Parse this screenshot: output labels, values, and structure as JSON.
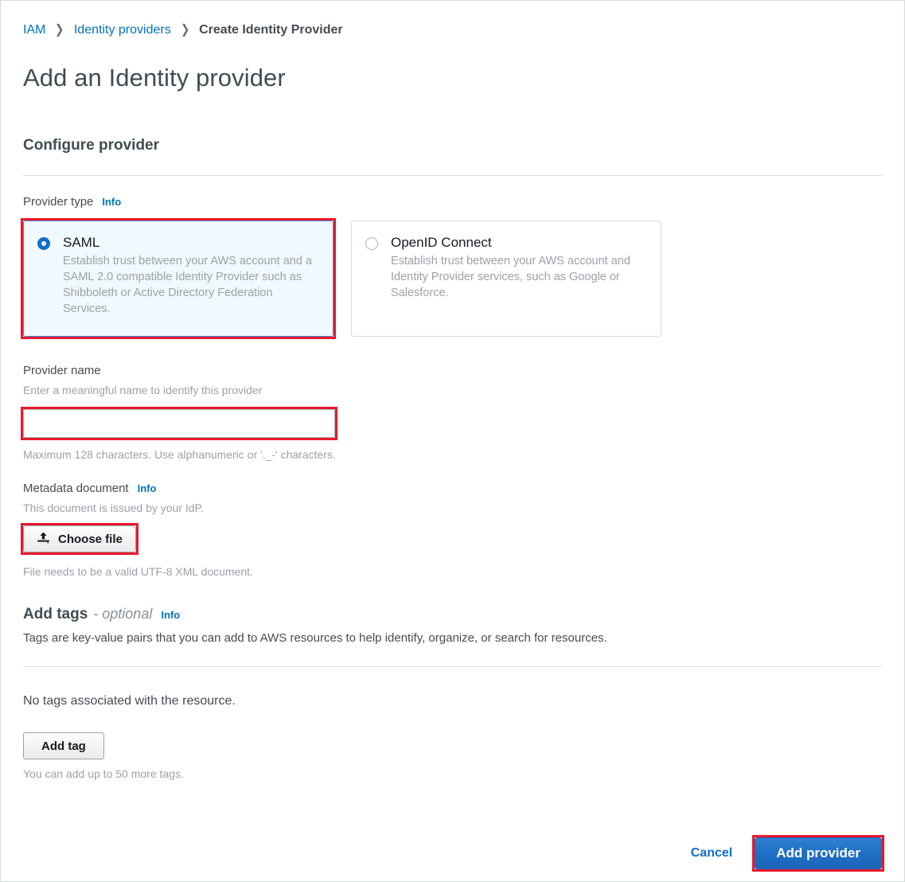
{
  "breadcrumb": {
    "items": [
      {
        "label": "IAM",
        "type": "link"
      },
      {
        "label": "Identity providers",
        "type": "link"
      },
      {
        "label": "Create Identity Provider",
        "type": "current"
      }
    ],
    "separator": "❯"
  },
  "page": {
    "title": "Add an Identity provider"
  },
  "configure": {
    "section_title": "Configure provider",
    "provider_type": {
      "label": "Provider type",
      "info_label": "Info",
      "options": [
        {
          "id": "saml",
          "title": "SAML",
          "description": "Establish trust between your AWS account and a SAML 2.0 compatible Identity Provider such as Shibboleth or Active Directory Federation Services.",
          "selected": true,
          "highlighted": true
        },
        {
          "id": "oidc",
          "title": "OpenID Connect",
          "description": "Establish trust between your AWS account and Identity Provider services, such as Google or Salesforce.",
          "selected": false,
          "highlighted": false
        }
      ]
    },
    "provider_name": {
      "label": "Provider name",
      "hint": "Enter a meaningful name to identify this provider",
      "value": "",
      "placeholder": "",
      "constraint": "Maximum 128 characters. Use alphanumeric or '._-' characters."
    },
    "metadata_document": {
      "label": "Metadata document",
      "info_label": "Info",
      "hint": "This document is issued by your IdP.",
      "choose_file_label": "Choose file",
      "choose_file_icon": "upload-icon",
      "constraint": "File needs to be a valid UTF-8 XML document."
    }
  },
  "tags": {
    "heading": "Add tags",
    "optional_label": "- optional",
    "info_label": "Info",
    "description": "Tags are key-value pairs that you can add to AWS resources to help identify, organize, or search for resources.",
    "empty_message": "No tags associated with the resource.",
    "add_tag_label": "Add tag",
    "limit_hint": "You can add up to 50 more tags."
  },
  "footer": {
    "cancel_label": "Cancel",
    "submit_label": "Add provider",
    "submit_highlighted": true
  },
  "colors": {
    "link_blue": "#0073bb",
    "primary_blue": "#1f6fc4",
    "highlight_red": "#e8192c",
    "selected_tile_bg": "#f1f8fe",
    "selected_tile_border": "#3d8bdb",
    "muted_text": "#9aa2a8",
    "body_text": "#444c52"
  }
}
